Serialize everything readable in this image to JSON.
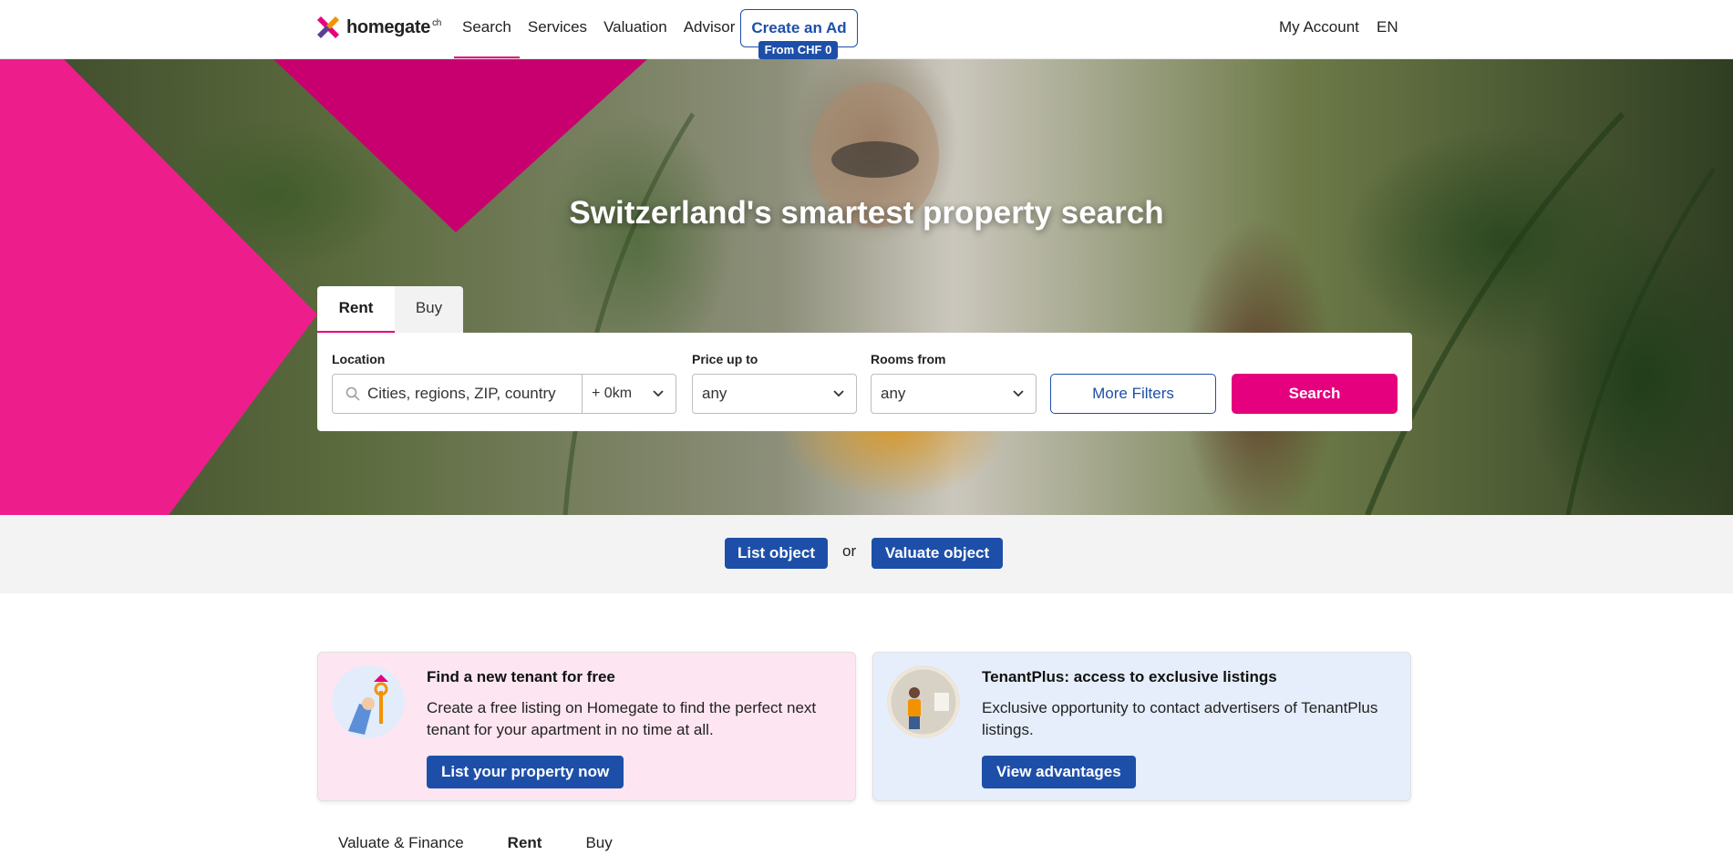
{
  "header": {
    "logo_text": "homegate",
    "logo_sup": "ch",
    "nav": [
      "Search",
      "Services",
      "Valuation",
      "Advisor"
    ],
    "create_ad": "Create an Ad",
    "create_ad_badge": "From CHF 0",
    "my_account": "My Account",
    "language": "EN"
  },
  "hero": {
    "title": "Switzerland's smartest property search"
  },
  "search": {
    "tabs": [
      "Rent",
      "Buy"
    ],
    "location_label": "Location",
    "location_placeholder": "Cities, regions, ZIP, country",
    "radius_value": "+ 0km",
    "price_label": "Price up to",
    "price_value": "any",
    "rooms_label": "Rooms from",
    "rooms_value": "any",
    "more_filters": "More Filters",
    "search_button": "Search"
  },
  "cta": {
    "list_object": "List object",
    "or": "or",
    "valuate_object": "Valuate object"
  },
  "cards": [
    {
      "title": "Find a new tenant for free",
      "text": "Create a free listing on Homegate to find the perfect next tenant for your apartment in no time at all.",
      "button": "List your property now"
    },
    {
      "title": "TenantPlus: access to exclusive listings",
      "text": "Exclusive opportunity to contact advertisers of TenantPlus listings.",
      "button": "View advantages"
    }
  ],
  "bottom_tabs": [
    "Valuate & Finance",
    "Rent",
    "Buy"
  ],
  "colors": {
    "brand_pink": "#e5007d",
    "brand_blue": "#1e4fa8"
  }
}
